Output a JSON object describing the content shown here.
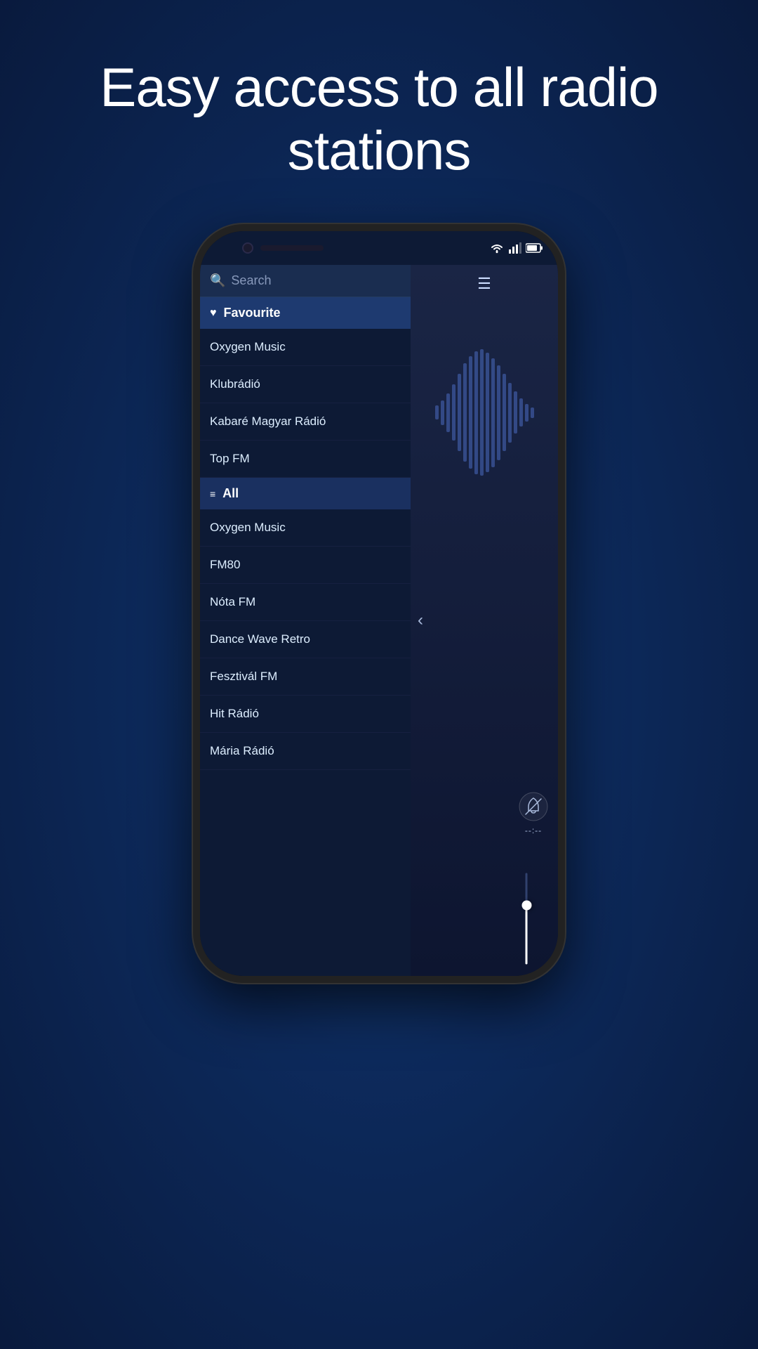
{
  "headline": {
    "line1": "Easy access to all radio",
    "line2": "stations"
  },
  "phone": {
    "status": {
      "wifi": "wifi",
      "signal": "signal",
      "battery": "battery"
    },
    "search": {
      "placeholder": "Search",
      "icon": "search"
    },
    "menu_icon": "☰",
    "favourite_section": {
      "label": "Favourite",
      "icon": "♥"
    },
    "favourite_items": [
      {
        "name": "Oxygen Music"
      },
      {
        "name": "Klubrádió"
      },
      {
        "name": "Kabaré Magyar Rádió"
      },
      {
        "name": "Top FM"
      }
    ],
    "all_section": {
      "label": "All",
      "icon": "≡"
    },
    "all_items": [
      {
        "name": "Oxygen Music"
      },
      {
        "name": "FM80"
      },
      {
        "name": "Nóta FM"
      },
      {
        "name": "Dance Wave Retro"
      },
      {
        "name": "Fesztivál FM"
      },
      {
        "name": "Hit Rádió"
      },
      {
        "name": "Mária Rádió"
      }
    ],
    "timer_dash": "--:--",
    "chevron": "‹"
  }
}
